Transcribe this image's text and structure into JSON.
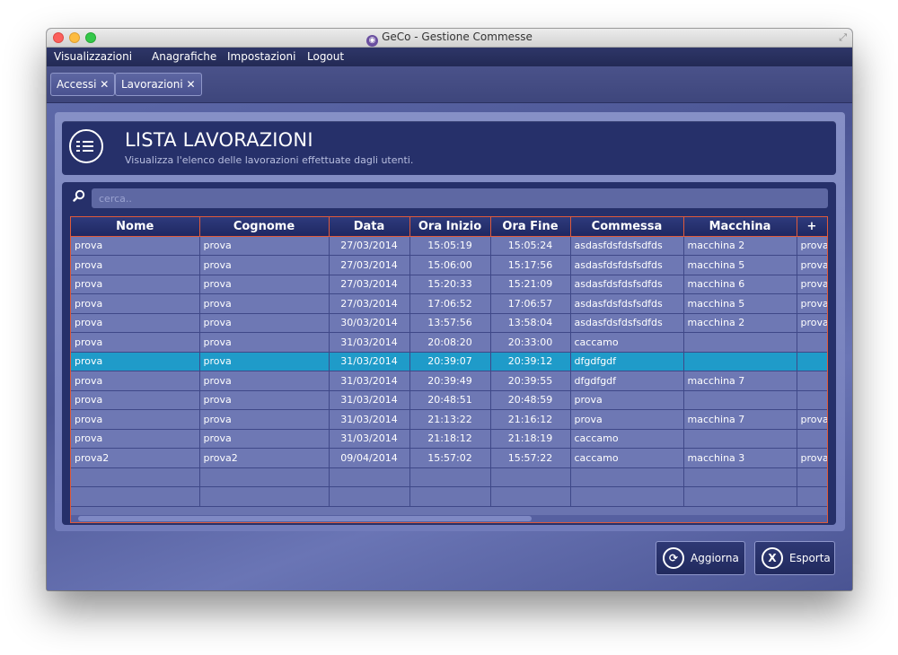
{
  "window": {
    "title": "GeCo - Gestione Commesse"
  },
  "menu": [
    "Visualizzazioni",
    "Anagrafiche",
    "Impostazioni",
    "Logout"
  ],
  "tabs": [
    {
      "label": "Accessi ✕"
    },
    {
      "label": "Lavorazioni ✕"
    }
  ],
  "header": {
    "title": "LISTA LAVORAZIONI",
    "subtitle": "Visualizza l'elenco delle lavorazioni effettuate dagli utenti."
  },
  "search": {
    "placeholder": "cerca.."
  },
  "table": {
    "columns": [
      "Nome",
      "Cognome",
      "Data",
      "Ora Inizio",
      "Ora Fine",
      "Commessa",
      "Macchina",
      "+"
    ],
    "rows": [
      [
        "prova",
        "prova",
        "27/03/2014",
        "15:05:19",
        "15:05:24",
        "asdasfdsfdsfsdfds",
        "macchina 2",
        "prova"
      ],
      [
        "prova",
        "prova",
        "27/03/2014",
        "15:06:00",
        "15:17:56",
        "asdasfdsfdsfsdfds",
        "macchina 5",
        "prova"
      ],
      [
        "prova",
        "prova",
        "27/03/2014",
        "15:20:33",
        "15:21:09",
        "asdasfdsfdsfsdfds",
        "macchina 6",
        "prova"
      ],
      [
        "prova",
        "prova",
        "27/03/2014",
        "17:06:52",
        "17:06:57",
        "asdasfdsfdsfsdfds",
        "macchina 5",
        "prova"
      ],
      [
        "prova",
        "prova",
        "30/03/2014",
        "13:57:56",
        "13:58:04",
        "asdasfdsfdsfsdfds",
        "macchina 2",
        "prova"
      ],
      [
        "prova",
        "prova",
        "31/03/2014",
        "20:08:20",
        "20:33:00",
        "caccamo",
        "",
        ""
      ],
      [
        "prova",
        "prova",
        "31/03/2014",
        "20:39:07",
        "20:39:12",
        "dfgdfgdf",
        "",
        ""
      ],
      [
        "prova",
        "prova",
        "31/03/2014",
        "20:39:49",
        "20:39:55",
        "dfgdfgdf",
        "macchina 7",
        ""
      ],
      [
        "prova",
        "prova",
        "31/03/2014",
        "20:48:51",
        "20:48:59",
        "prova",
        "",
        ""
      ],
      [
        "prova",
        "prova",
        "31/03/2014",
        "21:13:22",
        "21:16:12",
        "prova",
        "macchina 7",
        "prova"
      ],
      [
        "prova",
        "prova",
        "31/03/2014",
        "21:18:12",
        "21:18:19",
        "caccamo",
        "",
        ""
      ],
      [
        "prova2",
        "prova2",
        "09/04/2014",
        "15:57:02",
        "15:57:22",
        "caccamo",
        "macchina 3",
        "prova"
      ]
    ],
    "selected_row": 6,
    "empty_rows": 2
  },
  "buttons": {
    "refresh": {
      "label": "Aggiorna",
      "icon": "refresh-icon"
    },
    "export": {
      "label": "Esporta",
      "icon": "excel-export-icon"
    }
  },
  "colors": {
    "selection": "#1f9bc9",
    "accent_border": "#e05a3a",
    "panel_dark": "#26306a"
  }
}
